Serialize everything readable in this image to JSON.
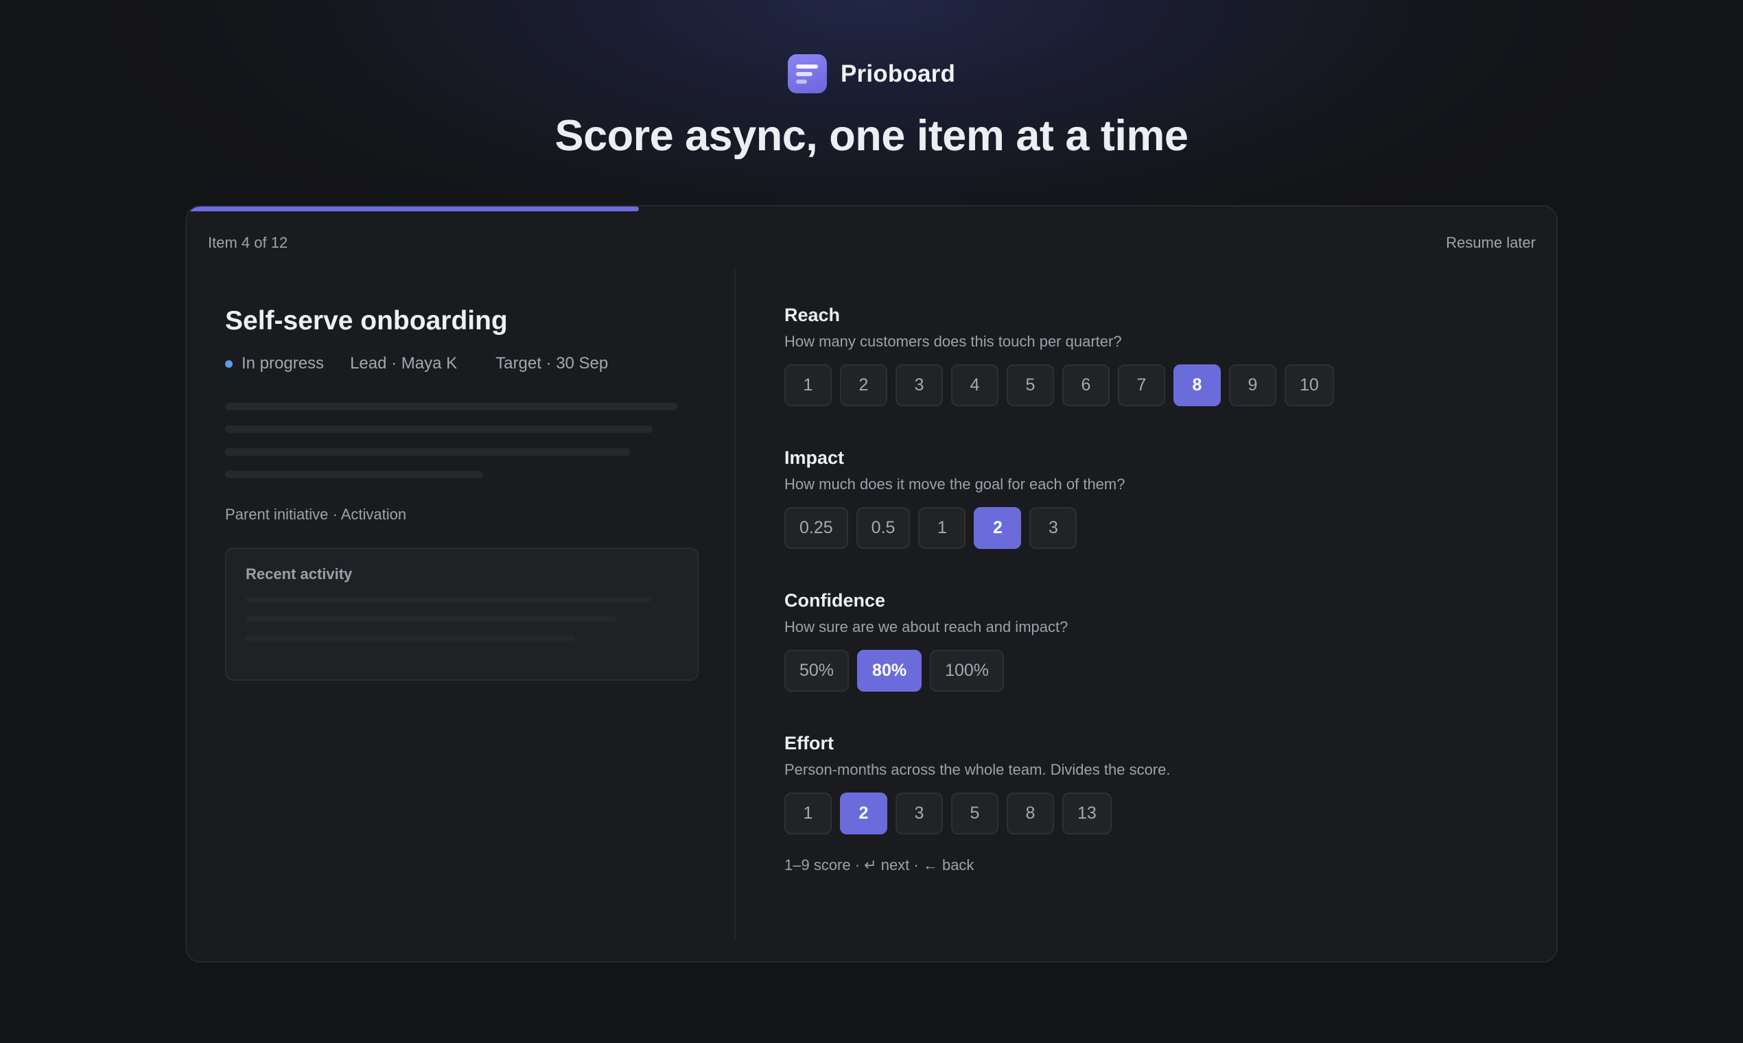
{
  "brand": {
    "name": "Prioboard",
    "logo_icon": "list-icon"
  },
  "headline": "Score async, one item at a time",
  "progress": {
    "label": "Item 4 of 12",
    "current": 4,
    "total": 12,
    "fraction": 0.33,
    "color": "#6d6be0"
  },
  "resume_label": "Resume later",
  "item": {
    "title": "Self-serve onboarding",
    "status": "In progress",
    "status_color": "#5c9de8",
    "lead": "Lead · Maya K",
    "target": "Target · 30 Sep",
    "parent": "Parent initiative · Activation",
    "activity_title": "Recent activity"
  },
  "sections": {
    "reach": {
      "title": "Reach",
      "description": "How many customers does this touch per quarter?",
      "options": [
        "1",
        "2",
        "3",
        "4",
        "5",
        "6",
        "7",
        "8",
        "9",
        "10"
      ],
      "selected": "8"
    },
    "impact": {
      "title": "Impact",
      "description": "How much does it move the goal for each of them?",
      "options": [
        "0.25",
        "0.5",
        "1",
        "2",
        "3"
      ],
      "selected": "2"
    },
    "confidence": {
      "title": "Confidence",
      "description": "How sure are we about reach and impact?",
      "options": [
        "50%",
        "80%",
        "100%"
      ],
      "selected": "80%"
    },
    "effort": {
      "title": "Effort",
      "description": "Person-months across the whole team. Divides the score.",
      "options": [
        "1",
        "2",
        "3",
        "5",
        "8",
        "13"
      ],
      "selected": "2"
    }
  },
  "shortcut_hint": "1–9 score · ↵ next · ← back",
  "accent_color": "#6c6bdc"
}
